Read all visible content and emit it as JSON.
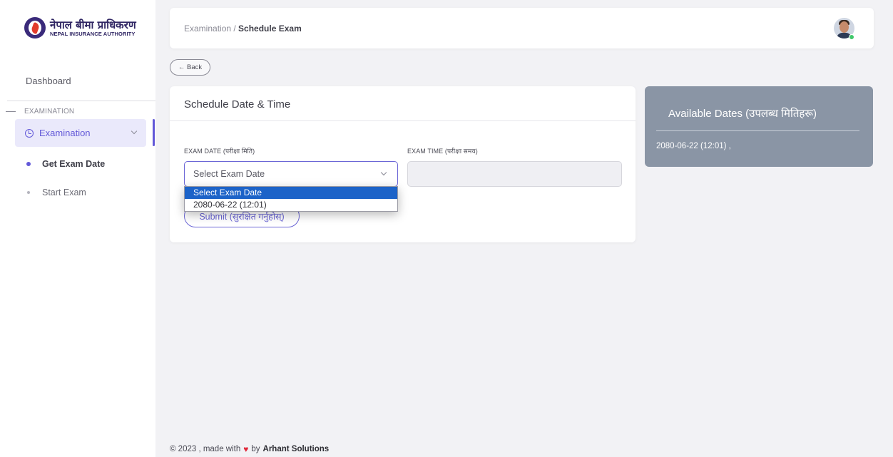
{
  "brand": {
    "name_np": "नेपाल बीमा प्राधिकरण",
    "name_en": "NEPAL INSURANCE AUTHORITY"
  },
  "sidebar": {
    "dashboard": "Dashboard",
    "section": "EXAMINATION",
    "active_item": "Examination",
    "sub_items": [
      {
        "label": "Get Exam Date"
      },
      {
        "label": "Start Exam"
      }
    ]
  },
  "header": {
    "breadcrumb_parent": "Examination / ",
    "breadcrumb_current": "Schedule Exam"
  },
  "back_button": "← Back",
  "form": {
    "title": "Schedule Date & Time",
    "exam_date_label": "EXAM DATE (परीक्षा मिति)",
    "exam_time_label": "EXAM TIME (परीक्षा समय)",
    "exam_date_value": "Select Exam Date",
    "exam_time_value": "",
    "submit_label": "Submit (सुरक्षित गर्नुहोस्)",
    "options": [
      "Select Exam Date",
      "2080-06-22 (12:01)"
    ]
  },
  "available": {
    "title": "Available Dates (उपलब्ध मितिहरू)",
    "items": [
      "2080-06-22 (12:01) ,"
    ]
  },
  "footer": {
    "prefix": "© 2023 , made with",
    "suffix": "by",
    "company": "Arhant Solutions"
  },
  "colors": {
    "accent": "#6258d8",
    "selected_option": "#1c63c8",
    "available_card": "#8a95a5",
    "online_status": "#3fc86a",
    "heart": "#e0283a"
  }
}
